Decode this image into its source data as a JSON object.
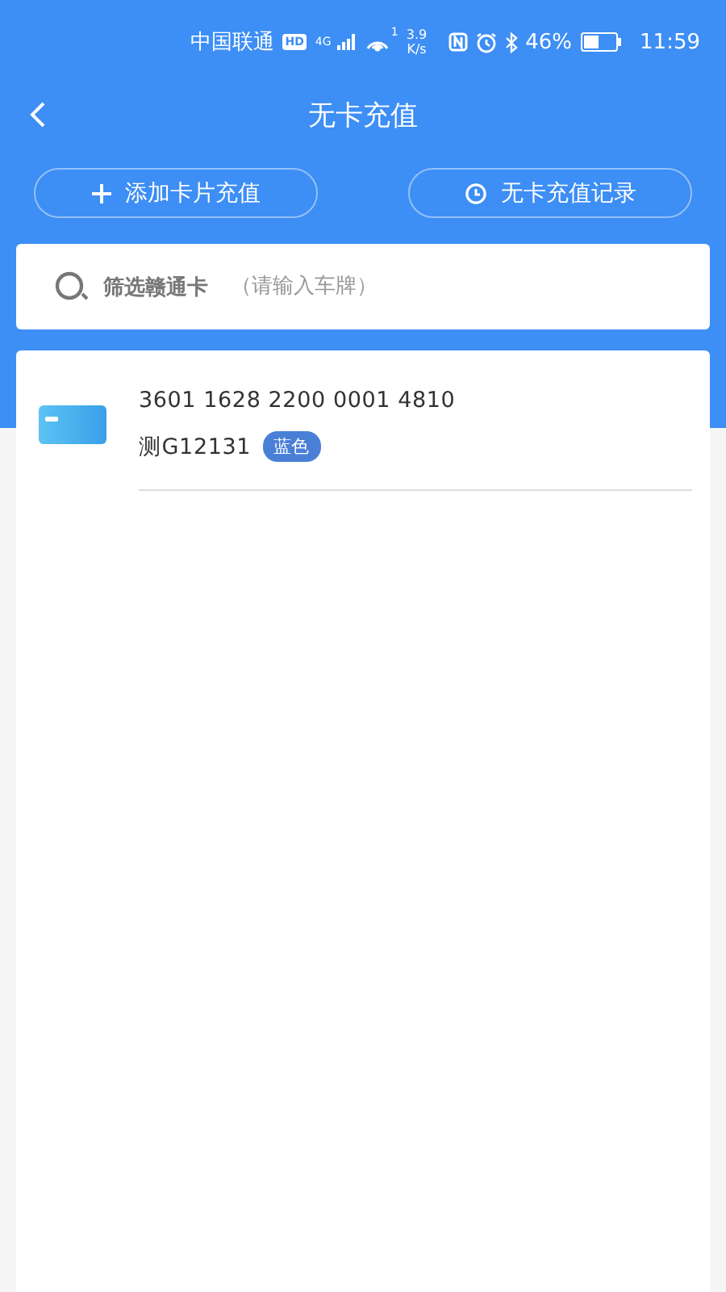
{
  "status_bar": {
    "carrier": "中国联通",
    "hd": "HD",
    "network": "4G",
    "wifi_sub": "1",
    "speed_value": "3.9",
    "speed_unit": "K/s",
    "battery": "46%",
    "time": "11:59"
  },
  "header": {
    "title": "无卡充值"
  },
  "actions": [
    {
      "label": "添加卡片充值",
      "kind": "add"
    },
    {
      "label": "无卡充值记录",
      "kind": "history"
    }
  ],
  "search": {
    "label": "筛选赣通卡",
    "placeholder": "（请输入车牌）"
  },
  "cards": [
    {
      "number": "3601 1628 2200 0001 4810",
      "plate": "测G12131",
      "plate_color": "蓝色",
      "color": "#4a7fd8"
    }
  ]
}
